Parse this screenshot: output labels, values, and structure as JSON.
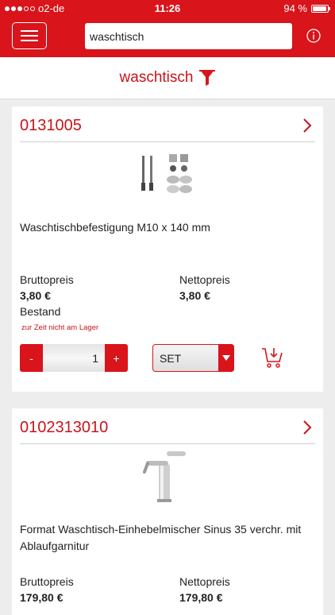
{
  "status_bar": {
    "carrier": "o2-de",
    "time": "11:26",
    "battery": "94 %",
    "battery_level": 0.94
  },
  "navbar": {
    "search_value": "waschtisch"
  },
  "filter": {
    "title": "waschtisch"
  },
  "products": [
    {
      "article_no": "0131005",
      "name": "Waschtischbefestigung M10 x 140 mm",
      "gross_label": "Bruttopreis",
      "gross_price": "3,80 €",
      "net_label": "Nettopreis",
      "net_price": "3,80 €",
      "stock_label": "Bestand",
      "stock_note": "zur Zeit nicht am Lager",
      "qty_minus": "-",
      "qty_value": "1",
      "qty_plus": "+",
      "unit": "SET"
    },
    {
      "article_no": "0102313010",
      "name": "Format Waschtisch-Einhebelmischer Sinus 35 verchr. mit Ablaufgarnitur",
      "gross_label": "Bruttopreis",
      "gross_price": "179,80 €",
      "net_label": "Nettopreis",
      "net_price": "179,80 €"
    }
  ],
  "colors": {
    "brand_red": "#d9141b",
    "text_red": "#c8141b"
  }
}
